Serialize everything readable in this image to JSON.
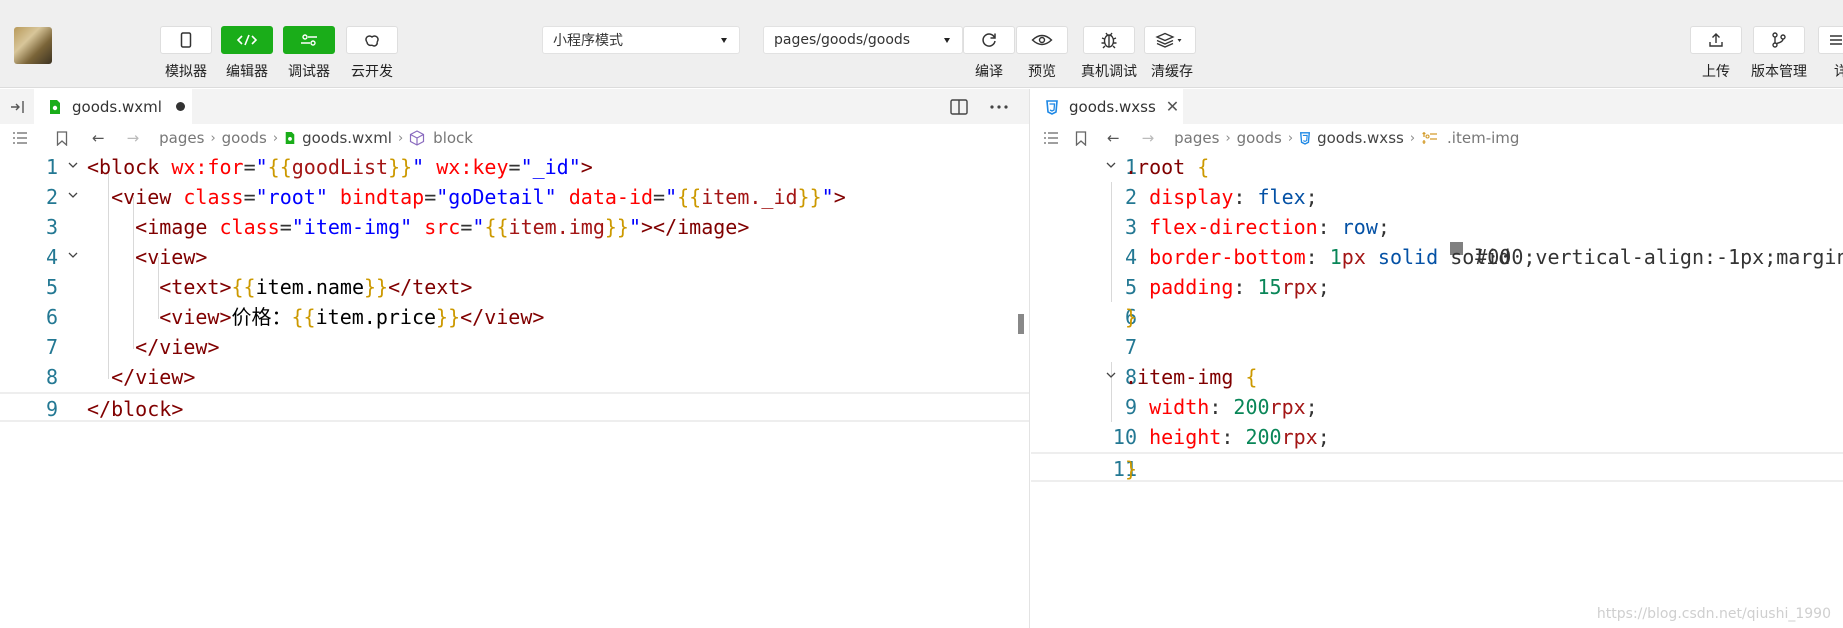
{
  "toolbar": {
    "left_buttons": [
      {
        "label": "模拟器",
        "icon": "phone-icon"
      },
      {
        "label": "编辑器",
        "icon": "code-icon"
      },
      {
        "label": "调试器",
        "icon": "debug-icon"
      },
      {
        "label": "云开发",
        "icon": "cloud-icon"
      }
    ],
    "mode_select": "小程序模式",
    "page_select": "pages/goods/goods",
    "mid_buttons": [
      {
        "label": "编译",
        "icon": "refresh-icon"
      },
      {
        "label": "预览",
        "icon": "eye-icon"
      },
      {
        "label": "真机调试",
        "icon": "bug-icon"
      },
      {
        "label": "清缓存",
        "icon": "layers-icon"
      }
    ],
    "right_buttons": [
      {
        "label": "上传",
        "icon": "upload-icon"
      },
      {
        "label": "版本管理",
        "icon": "branch-icon"
      },
      {
        "label": "详",
        "icon": "details-icon"
      }
    ]
  },
  "left_editor": {
    "tab_name": "goods.wxml",
    "breadcrumb": [
      "pages",
      "goods",
      "goods.wxml",
      "block"
    ],
    "lines": [
      "<block wx:for=\"{{goodList}}\" wx:key=\"_id\">",
      "  <view class=\"root\" bindtap=\"goDetail\" data-id=\"{{item._id}}\">",
      "    <image class=\"item-img\" src=\"{{item.img}}\"></image>",
      "    <view>",
      "      <text>{{item.name}}</text>",
      "      <view>价格：{{item.price}}</view>",
      "    </view>",
      "  </view>",
      "</block>"
    ]
  },
  "right_editor": {
    "tab_name": "goods.wxss",
    "breadcrumb": [
      "pages",
      "goods",
      "goods.wxss",
      ".item-img"
    ],
    "lines": [
      ".root {",
      "  display: flex;",
      "  flex-direction: row;",
      "  border-bottom: 1px solid ■gray;",
      "  padding: 15rpx;",
      "}",
      "",
      ".item-img {",
      "  width: 200rpx;",
      "  height: 200rpx;",
      "}"
    ]
  },
  "watermark": "https://blog.csdn.net/qiushi_1990",
  "colors": {
    "green": "#1aad19",
    "toolbar_bg": "#efefef",
    "line_number": "#237893",
    "wxml_tag": "#800000",
    "wxml_attr": "#ff0000",
    "wxml_string": "#0000ff",
    "css_selector": "#800000",
    "css_property": "#ff0000",
    "css_number": "#098658",
    "mustache_brace": "#cc9900"
  }
}
